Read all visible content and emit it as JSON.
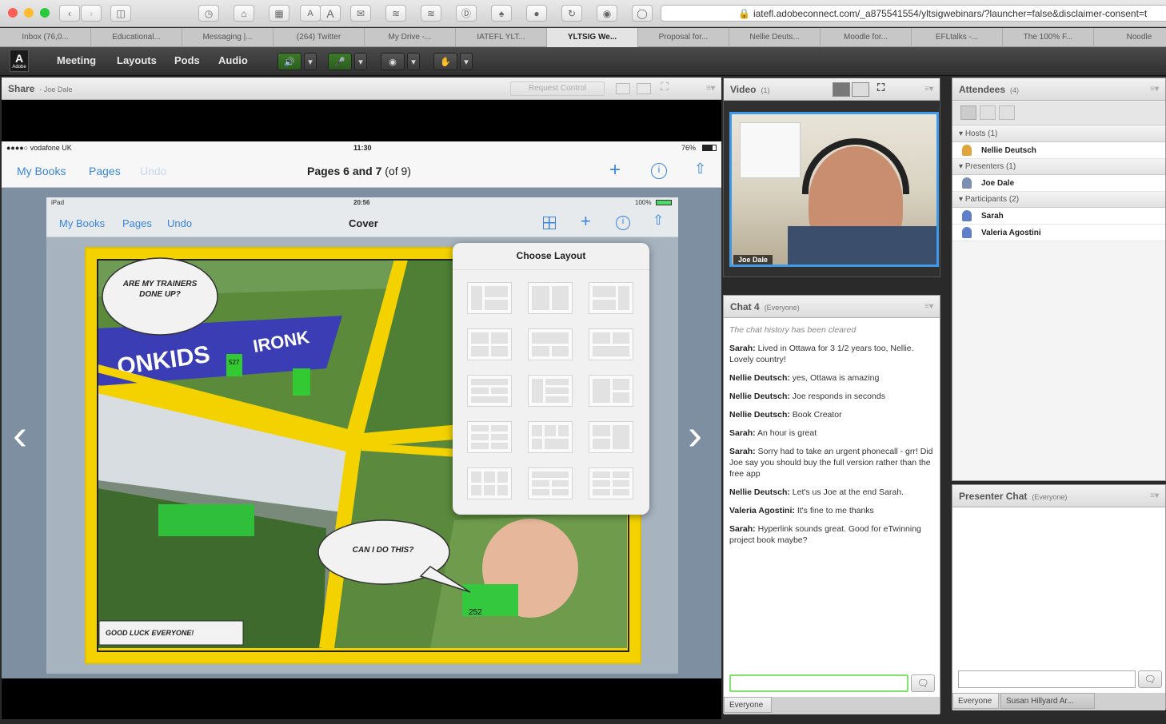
{
  "browser": {
    "url": "iatefl.adobeconnect.com/_a875541554/yltsigwebinars/?launcher=false&disclaimer-consent=t",
    "tabs": [
      "Inbox (76,0...",
      "Educational...",
      "Messaging |...",
      "(264) Twitter",
      "My Drive -...",
      "IATEFL YLT...",
      "YLTSIG We...",
      "Proposal for...",
      "Nellie Deuts...",
      "Moodle for...",
      "EFLtalks -...",
      "The 100% F...",
      "Noodle"
    ],
    "active_tab_index": 6,
    "font_buttons": [
      "A",
      "A"
    ]
  },
  "app_menu": {
    "logo": "Adobe",
    "items": [
      "Meeting",
      "Layouts",
      "Pods",
      "Audio"
    ]
  },
  "share": {
    "title": "Share",
    "presenter": "- Joe Dale",
    "request_control": "Request Control"
  },
  "ipad_outer": {
    "carrier": "●●●●○ vodafone UK",
    "time": "11:30",
    "battery": "76%",
    "nav": {
      "my_books": "My Books",
      "pages": "Pages",
      "undo": "Undo"
    },
    "title_bold": "Pages 6 and 7",
    "title_rest": "(of 9)"
  },
  "ipad_inner": {
    "device": "iPad",
    "time": "20:56",
    "battery": "100%",
    "nav": {
      "my_books": "My Books",
      "pages": "Pages",
      "undo": "Undo"
    },
    "title": "Cover"
  },
  "comic": {
    "bubble1": "ARE MY TRAINERS DONE UP?",
    "bubble2": "CAN I DO THIS?",
    "caption": "GOOD LUCK EVERYONE!",
    "banner_left": "ONKIDS",
    "banner_right": "IRONK",
    "bib1": "527",
    "bib2": "252"
  },
  "popover": {
    "title": "Choose Layout"
  },
  "video": {
    "title": "Video",
    "count": "(1)",
    "name_tag": "Joe Dale"
  },
  "chat": {
    "title": "Chat 4",
    "scope": "(Everyone)",
    "cleared": "The chat history has been cleared",
    "messages": [
      {
        "name": "Sarah:",
        "text": "Lived in Ottawa for 3 1/2 years too, Nellie. Lovely country!"
      },
      {
        "name": "Nellie Deutsch:",
        "text": "yes, Ottawa is amazing"
      },
      {
        "name": "Nellie Deutsch:",
        "text": "Joe responds in seconds"
      },
      {
        "name": "Nellie Deutsch:",
        "text": "Book Creator"
      },
      {
        "name": "Sarah:",
        "text": "An hour is great"
      },
      {
        "name": "Sarah:",
        "text": "Sorry had to take an urgent phonecall - grr! Did Joe say you should buy the full version rather than the free app"
      },
      {
        "name": "Nellie Deutsch:",
        "text": "Let's us Joe at the end Sarah."
      },
      {
        "name": "Valeria Agostini:",
        "text": "It's fine to me thanks"
      },
      {
        "name": "Sarah:",
        "text": "Hyperlink sounds great. Good for eTwinning project book maybe?"
      }
    ],
    "footer_tab": "Everyone"
  },
  "attendees": {
    "title": "Attendees",
    "count": "(4)",
    "groups": [
      {
        "label": "Hosts (1)",
        "members": [
          "Nellie Deutsch"
        ]
      },
      {
        "label": "Presenters (1)",
        "members": [
          "Joe Dale"
        ]
      },
      {
        "label": "Participants (2)",
        "members": [
          "Sarah",
          "Valeria Agostini"
        ]
      }
    ]
  },
  "presenter_chat": {
    "title": "Presenter Chat",
    "scope": "(Everyone)",
    "tabs": [
      "Everyone",
      "Susan Hillyard Ar..."
    ]
  }
}
